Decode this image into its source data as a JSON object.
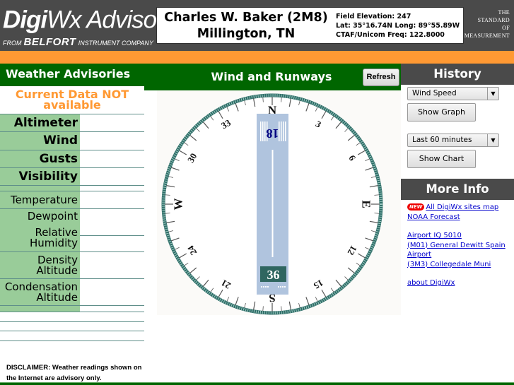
{
  "header": {
    "logo": {
      "brand_part1": "Digi",
      "brand_part2": "Wx Advisor",
      "trademark": "™",
      "from_text": "FROM",
      "company_brand": "BELFORT",
      "company_suffix": "INSTRUMENT COMPANY"
    },
    "airport": {
      "name_line1": "Charles W. Baker (2M8)",
      "name_line2": "Millington, TN",
      "field_elevation": "Field Elevation: 247",
      "lat_long": "Lat: 35°16.74N  Long: 89°55.89W",
      "ctaf": "CTAF/Unicom Freq: 122.8000"
    },
    "tagline": [
      "THE",
      "STANDARD",
      "OF",
      "MEASUREMENT"
    ]
  },
  "weather_advisories": {
    "title": "Weather Advisories",
    "status_line1": "Current Data  NOT",
    "status_line2": "available",
    "primary_rows": [
      {
        "label": "Altimeter",
        "value": ""
      },
      {
        "label": "Wind",
        "value": ""
      },
      {
        "label": "Gusts",
        "value": ""
      },
      {
        "label": "Visibility",
        "value": ""
      }
    ],
    "secondary_rows": [
      {
        "label_line1": "Temperature",
        "label_line2": "",
        "value": ""
      },
      {
        "label_line1": "Dewpoint",
        "label_line2": "",
        "value": ""
      },
      {
        "label_line1": "Relative",
        "label_line2": "Humidity",
        "value": ""
      },
      {
        "label_line1": "Density",
        "label_line2": "Altitude",
        "value": ""
      },
      {
        "label_line1": "Condensation",
        "label_line2": "Altitude",
        "value": ""
      }
    ],
    "disclaimer": "DISCLAIMER: Weather readings shown on the Internet are advisory only."
  },
  "wind_runways": {
    "title": "Wind and Runways",
    "refresh_label": "Refresh",
    "compass": {
      "cardinals": {
        "north": "N",
        "east": "E",
        "south": "S",
        "west": "W"
      },
      "heading_labels": [
        "3",
        "6",
        "12",
        "15",
        "21",
        "24",
        "30",
        "33"
      ],
      "ring_color": "#2f6e68"
    },
    "runway": {
      "end_top": "18",
      "end_bottom": "36",
      "color": "#b0c4de",
      "bottom_badge_color": "#2f6660",
      "top_number_color": "#000080"
    }
  },
  "history": {
    "title": "History",
    "metric_select": "Wind Speed",
    "show_graph_label": "Show Graph",
    "period_select": "Last 60 minutes",
    "show_chart_label": "Show Chart"
  },
  "more_info": {
    "title": "More Info",
    "new_badge": "NEW",
    "links": [
      "All DigiWx sites map",
      "NOAA Forecast",
      "Airport IQ 5010",
      "(M01) General Dewitt Spain Airport",
      "(3M3) Collegedale Muni",
      "about DigiWx"
    ]
  },
  "colors": {
    "header_gray": "#4a4a4a",
    "accent_orange": "#ff9933",
    "section_green": "#006600",
    "label_green": "#99cc99",
    "link_blue": "#0000cc"
  }
}
